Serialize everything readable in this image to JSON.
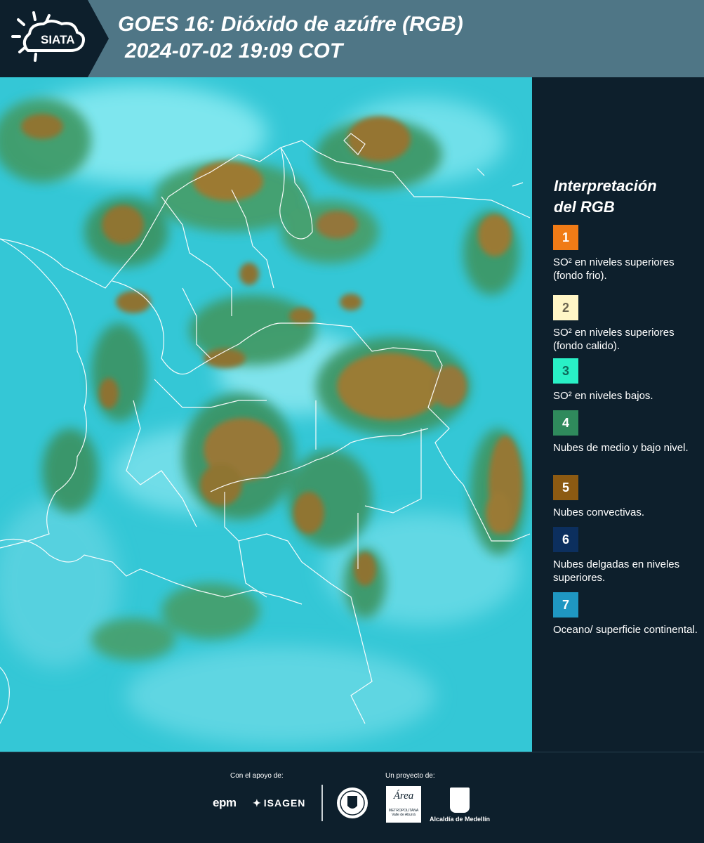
{
  "header": {
    "logo_text": "SIATA",
    "title": "GOES 16: Dióxido de azúfre (RGB)",
    "subtitle": "2024-07-02 19:09 COT"
  },
  "legend": {
    "title_line1": "Interpretación",
    "title_line2": "del RGB",
    "items": [
      {
        "number": "1",
        "color": "#f07b16",
        "text_color": "#ffffff",
        "label": "SO² en niveles superiores (fondo frio)."
      },
      {
        "number": "2",
        "color": "#fff6c6",
        "text_color": "#6b6550",
        "label": "SO² en niveles superiores (fondo calido)."
      },
      {
        "number": "3",
        "color": "#29f0c6",
        "text_color": "#0d6a5a",
        "label": "SO² en niveles bajos."
      },
      {
        "number": "4",
        "color": "#2f8a5c",
        "text_color": "#ffffff",
        "label": "Nubes de medio y bajo nivel."
      },
      {
        "number": "5",
        "color": "#8c5a12",
        "text_color": "#ffffff",
        "label": "Nubes convectivas."
      },
      {
        "number": "6",
        "color": "#0c2f5e",
        "text_color": "#ffffff",
        "label": "Nubes delgadas en niveles superiores."
      },
      {
        "number": "7",
        "color": "#1f97c2",
        "text_color": "#ffffff",
        "label": "Oceano/ superficie continental."
      }
    ]
  },
  "footer": {
    "support_label": "Con el apoyo de:",
    "project_label": "Un proyecto de:",
    "sponsor1": "epm",
    "sponsor2": "ISAGEN",
    "area_logo_text": "Área",
    "area_sub": "METROPOLITANA Valle de Aburrá",
    "alcaldia_label": "Alcaldía de Medellín"
  }
}
